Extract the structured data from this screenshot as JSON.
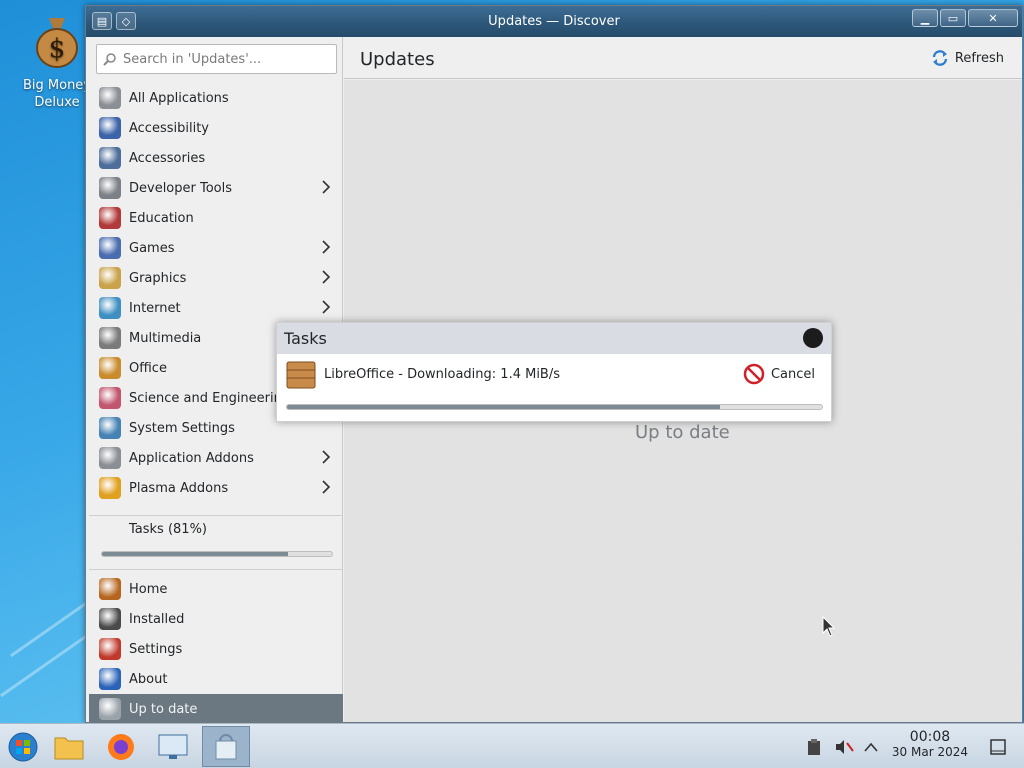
{
  "desktop": {
    "icon_label": "Big Money Deluxe"
  },
  "window": {
    "title": "Updates — Discover"
  },
  "search": {
    "placeholder": "Search in 'Updates'..."
  },
  "categories": [
    {
      "label": "All Applications",
      "icon": "grid-icon",
      "color": "#8a8f96"
    },
    {
      "label": "Accessibility",
      "icon": "accessibility-icon",
      "color": "#3c63a8"
    },
    {
      "label": "Accessories",
      "icon": "accessories-icon",
      "color": "#4d6d9a"
    },
    {
      "label": "Developer Tools",
      "icon": "developer-tools-icon",
      "color": "#7c8187"
    },
    {
      "label": "Education",
      "icon": "education-icon",
      "color": "#b23a3a"
    },
    {
      "label": "Games",
      "icon": "games-icon",
      "color": "#4a6db0"
    },
    {
      "label": "Graphics",
      "icon": "graphics-icon",
      "color": "#c9a24a"
    },
    {
      "label": "Internet",
      "icon": "internet-icon",
      "color": "#3f8fc2"
    },
    {
      "label": "Multimedia",
      "icon": "multimedia-icon",
      "color": "#7b7b7b"
    },
    {
      "label": "Office",
      "icon": "office-icon",
      "color": "#c98b2d"
    },
    {
      "label": "Science and Engineering",
      "icon": "science-icon",
      "color": "#c2566f"
    },
    {
      "label": "System Settings",
      "icon": "system-settings-icon",
      "color": "#4682b4"
    },
    {
      "label": "Application Addons",
      "icon": "application-addons-icon",
      "color": "#8a8f96"
    },
    {
      "label": "Plasma Addons",
      "icon": "plasma-addons-icon",
      "color": "#e0a020"
    }
  ],
  "tasks": {
    "label": "Tasks (81%)",
    "progress": 0.81
  },
  "nav": [
    {
      "label": "Home",
      "icon": "home-icon"
    },
    {
      "label": "Installed",
      "icon": "installed-icon"
    },
    {
      "label": "Settings",
      "icon": "settings-icon"
    },
    {
      "label": "About",
      "icon": "about-icon"
    },
    {
      "label": "Up to date",
      "icon": "update-status-icon"
    }
  ],
  "header": {
    "title": "Updates",
    "refresh_label": "Refresh"
  },
  "content": {
    "status": "Up to date"
  },
  "dialog": {
    "title": "Tasks",
    "item_text": "LibreOffice - Downloading: 1.4 MiB/s",
    "cancel_label": "Cancel",
    "progress": 0.81
  },
  "taskbar": {
    "time": "00:08",
    "date": "30 Mar 2024"
  }
}
